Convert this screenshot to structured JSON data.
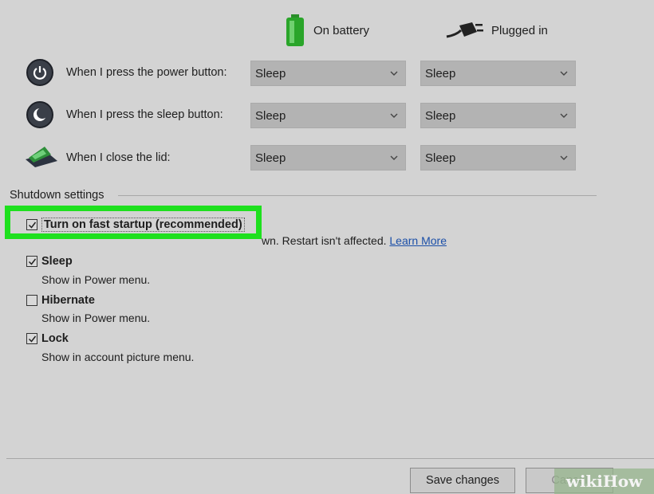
{
  "columns": {
    "on_battery": "On battery",
    "plugged_in": "Plugged in"
  },
  "rows": [
    {
      "label": "When I press the power button:",
      "battery": "Sleep",
      "plugged": "Sleep"
    },
    {
      "label": "When I press the sleep button:",
      "battery": "Sleep",
      "plugged": "Sleep"
    },
    {
      "label": "When I close the lid:",
      "battery": "Sleep",
      "plugged": "Sleep"
    }
  ],
  "shutdown": {
    "title": "Shutdown settings",
    "fast_startup": {
      "label": "Turn on fast startup (recommended)",
      "checked": true,
      "desc": "wn. Restart isn't affected.",
      "link": "Learn More"
    },
    "sleep": {
      "label": "Sleep",
      "desc": "Show in Power menu.",
      "checked": true
    },
    "hibernate": {
      "label": "Hibernate",
      "desc": "Show in Power menu.",
      "checked": false
    },
    "lock": {
      "label": "Lock",
      "desc": "Show in account picture menu.",
      "checked": true
    }
  },
  "footer": {
    "save": "Save changes",
    "cancel": "Cancel"
  },
  "watermark": "wikiHow",
  "colors": {
    "highlight": "#1ee01e",
    "link": "#1b4fa8",
    "battery": "#2a8f2a"
  }
}
